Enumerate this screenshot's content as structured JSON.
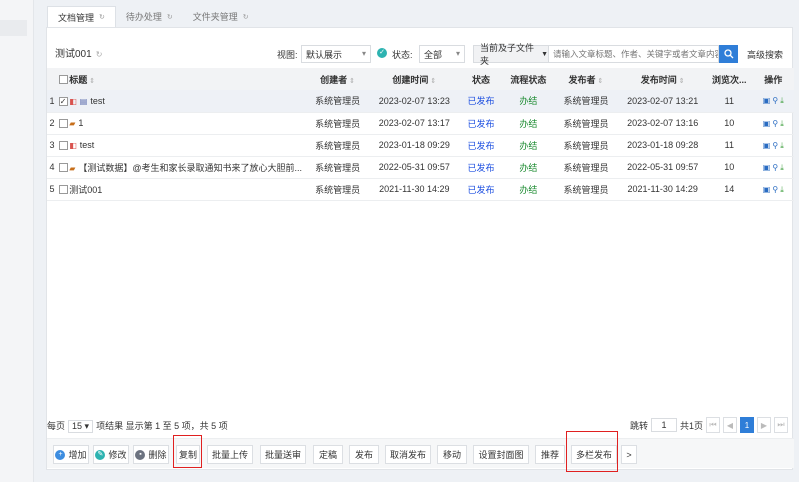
{
  "tabs": [
    {
      "label": "文档管理",
      "active": true
    },
    {
      "label": "待办处理",
      "active": false
    },
    {
      "label": "文件夹管理",
      "active": false
    }
  ],
  "toolbar": {
    "title": "测试001",
    "view_label": "视图:",
    "view_value": "默认展示",
    "status_label": "状态:",
    "status_value": "全部",
    "scope_value": "当前及子文件夹",
    "search_placeholder": "请输入文章标题、作者、关键字或者文章内容",
    "advanced_search": "高级搜索"
  },
  "table": {
    "headers": [
      "标题",
      "创建者",
      "创建时间",
      "状态",
      "流程状态",
      "发布者",
      "发布时间",
      "浏览次...",
      "操作"
    ],
    "rows": [
      {
        "no": "1",
        "checked": true,
        "title": "test",
        "icon": "html-doc-icon",
        "creator": "系统管理员",
        "created": "2023-02-07 13:23",
        "status": "已发布",
        "flow": "办结",
        "publisher": "系统管理员",
        "published": "2023-02-07 13:21",
        "views": "11"
      },
      {
        "no": "2",
        "checked": false,
        "title": "1",
        "icon": "image-icon",
        "creator": "系统管理员",
        "created": "2023-02-07 13:17",
        "status": "已发布",
        "flow": "办结",
        "publisher": "系统管理员",
        "published": "2023-02-07 13:16",
        "views": "10"
      },
      {
        "no": "3",
        "checked": false,
        "title": "test",
        "icon": "html-icon",
        "creator": "系统管理员",
        "created": "2023-01-18 09:29",
        "status": "已发布",
        "flow": "办结",
        "publisher": "系统管理员",
        "published": "2023-01-18 09:28",
        "views": "11"
      },
      {
        "no": "4",
        "checked": false,
        "title": "【测试数据】@考生和家长录取通知书来了放心大胆前...",
        "icon": "image-icon",
        "creator": "系统管理员",
        "created": "2022-05-31 09:57",
        "status": "已发布",
        "flow": "办结",
        "publisher": "系统管理员",
        "published": "2022-05-31 09:57",
        "views": "10"
      },
      {
        "no": "5",
        "checked": false,
        "title": "测试001",
        "icon": "",
        "creator": "系统管理员",
        "created": "2021-11-30 14:29",
        "status": "已发布",
        "flow": "办结",
        "publisher": "系统管理员",
        "published": "2021-11-30 14:29",
        "views": "14"
      }
    ]
  },
  "pager": {
    "per_page_label": "每页",
    "per_page": "15",
    "summary": "项结果 显示第 1 至 5 项，共 5 项",
    "jump_label": "跳转",
    "jump_value": "1",
    "total_pages": "共1页",
    "current": "1"
  },
  "actions": [
    "增加",
    "修改",
    "删除",
    "复制",
    "批量上传",
    "批量送审",
    "定稿",
    "发布",
    "取消发布",
    "移动",
    "设置封面图",
    "推荐",
    "多栏发布",
    ">"
  ]
}
